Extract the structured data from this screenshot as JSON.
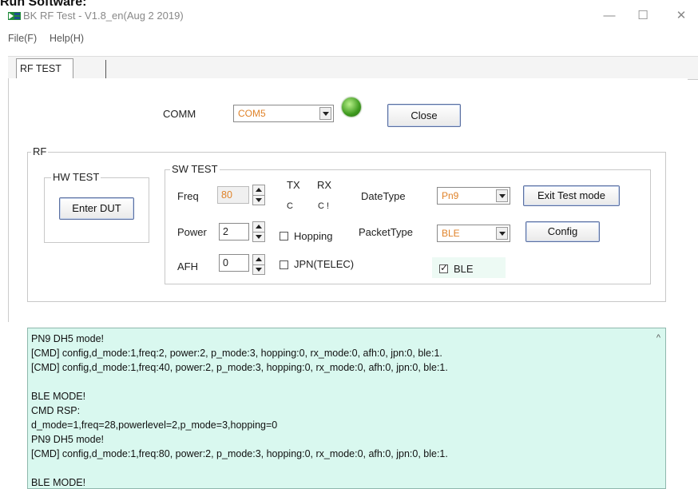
{
  "page_heading": "Run Software:",
  "window": {
    "title": "BK RF Test - V1.8_en(Aug  2 2019)",
    "logo_icon": "bk-logo-icon",
    "controls": {
      "minimize": "—",
      "maximize": "☐",
      "close": "✕"
    }
  },
  "menu": {
    "file": "File(F)",
    "help": "Help(H)"
  },
  "tabs": [
    {
      "label": "RF TEST"
    },
    {
      "label": ""
    }
  ],
  "comm": {
    "label": "COMM",
    "port_value": "COM5",
    "status_led_color": "#3e9a1e",
    "close_button": "Close"
  },
  "rf": {
    "group_title": "RF",
    "hw_test": {
      "title": "HW TEST",
      "enter_dut_button": "Enter DUT"
    },
    "sw_test": {
      "title": "SW TEST",
      "freq": {
        "label": "Freq",
        "value": "80"
      },
      "power": {
        "label": "Power",
        "value": "2"
      },
      "afh": {
        "label": "AFH",
        "value": "0"
      },
      "tx": {
        "label": "TX",
        "radio": "C"
      },
      "rx": {
        "label": "RX",
        "radio": "C !"
      },
      "hopping": {
        "label": "Hopping",
        "checked": false
      },
      "jpn": {
        "label": "JPN(TELEC)",
        "checked": false
      },
      "date_type": {
        "label": "DateType",
        "value": "Pn9"
      },
      "packet_type": {
        "label": "PacketType",
        "value": "BLE"
      },
      "ble": {
        "label": "BLE",
        "checked": true
      },
      "exit_test_button": "Exit Test mode",
      "config_button": "Config"
    }
  },
  "log": {
    "lines": [
      "PN9 DH5 mode!",
      "[CMD] config,d_mode:1,freq:2, power:2, p_mode:3, hopping:0, rx_mode:0, afh:0, jpn:0, ble:1.",
      "[CMD] config,d_mode:1,freq:40, power:2, p_mode:3, hopping:0, rx_mode:0, afh:0, jpn:0, ble:1.",
      "",
      "BLE MODE!",
      "CMD RSP:",
      "d_mode=1,freq=28,powerlevel=2,p_mode=3,hopping=0",
      "PN9 DH5 mode!",
      "[CMD] config,d_mode:1,freq:80, power:2, p_mode:3, hopping:0, rx_mode:0, afh:0, jpn:0, ble:1.",
      "",
      "BLE MODE!"
    ],
    "scroll_up_glyph": "^"
  },
  "colors": {
    "accent_value_text": "#e0832a",
    "log_background": "#d9f8ef",
    "button_border": "#5a6fa0"
  }
}
